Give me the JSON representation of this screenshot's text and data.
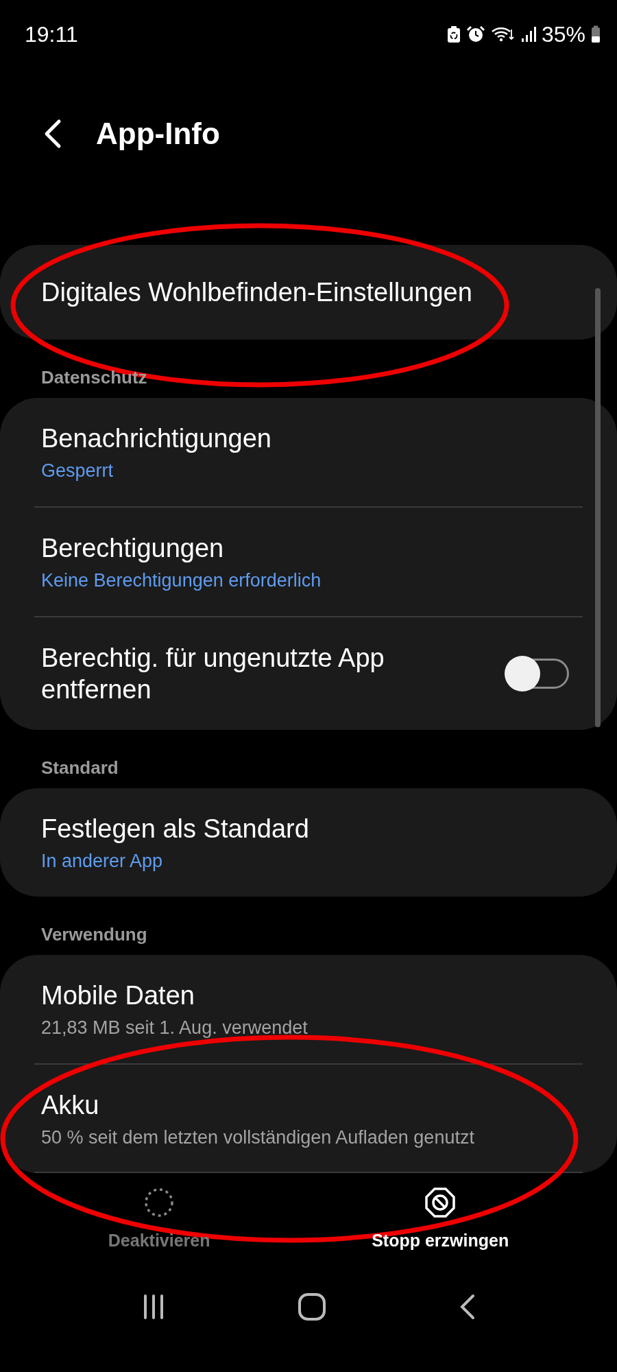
{
  "status_bar": {
    "time": "19:11",
    "battery": "35%"
  },
  "header": {
    "title": "App-Info"
  },
  "sections": [
    {
      "items": [
        {
          "kind": "link",
          "title": "Digitales Wohlbefinden-Einstellungen"
        }
      ]
    },
    {
      "heading": "Datenschutz",
      "items": [
        {
          "kind": "link",
          "title": "Benachrichtigungen",
          "subtitle": "Gesperrt",
          "accent": true
        },
        {
          "kind": "link",
          "title": "Berechtigungen",
          "subtitle": "Keine Berechtigungen erforderlich",
          "accent": true
        },
        {
          "kind": "toggle",
          "title": "Berechtig. für ungenutzte App entfernen",
          "on": false
        }
      ]
    },
    {
      "heading": "Standard",
      "items": [
        {
          "kind": "link",
          "title": "Festlegen als Standard",
          "subtitle": "In anderer App",
          "accent": true
        }
      ]
    },
    {
      "heading": "Verwendung",
      "items": [
        {
          "kind": "link",
          "title": "Mobile Daten",
          "subtitle": "21,83 MB seit 1. Aug. verwendet",
          "accent": false
        },
        {
          "kind": "link",
          "title": "Akku",
          "subtitle": "50 % seit dem letzten vollständigen Aufladen genutzt",
          "accent": false
        }
      ]
    }
  ],
  "bottom_actions": [
    {
      "kind": "disable",
      "label": "Deaktivieren",
      "disabled": true
    },
    {
      "kind": "stop",
      "label": "Stopp erzwingen",
      "disabled": false
    }
  ]
}
